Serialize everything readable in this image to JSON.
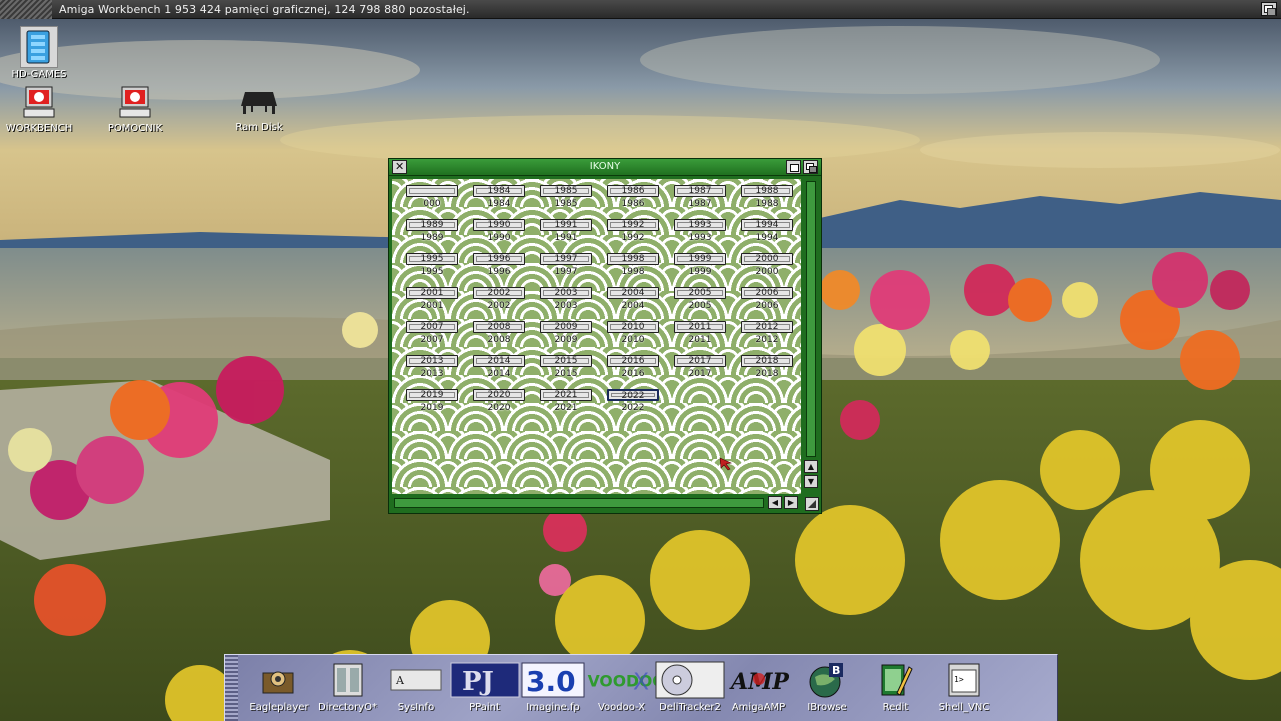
{
  "screen": {
    "title": "Amiga Workbench  1 953 424 pamięci graficznej, 124 798 880 pozostałej."
  },
  "desktop_icons": [
    {
      "label": "HD-GAMES"
    },
    {
      "label": "WORKBENCH"
    },
    {
      "label": "POMOCNIK"
    },
    {
      "label": "Ram Disk"
    }
  ],
  "window": {
    "title": "IKONY",
    "icons": [
      {
        "drawer": "",
        "label": "000"
      },
      {
        "drawer": "1984",
        "label": "1984"
      },
      {
        "drawer": "1985",
        "label": "1985"
      },
      {
        "drawer": "1986",
        "label": "1986"
      },
      {
        "drawer": "1987",
        "label": "1987"
      },
      {
        "drawer": "1988",
        "label": "1988"
      },
      {
        "drawer": "1989",
        "label": "1989"
      },
      {
        "drawer": "1990",
        "label": "1990"
      },
      {
        "drawer": "1991",
        "label": "1991"
      },
      {
        "drawer": "1992",
        "label": "1992"
      },
      {
        "drawer": "1993",
        "label": "1993"
      },
      {
        "drawer": "1994",
        "label": "1994"
      },
      {
        "drawer": "1995",
        "label": "1995"
      },
      {
        "drawer": "1996",
        "label": "1996"
      },
      {
        "drawer": "1997",
        "label": "1997"
      },
      {
        "drawer": "1998",
        "label": "1998"
      },
      {
        "drawer": "1999",
        "label": "1999"
      },
      {
        "drawer": "2000",
        "label": "2000"
      },
      {
        "drawer": "2001",
        "label": "2001"
      },
      {
        "drawer": "2002",
        "label": "2002"
      },
      {
        "drawer": "2003",
        "label": "2003"
      },
      {
        "drawer": "2004",
        "label": "2004"
      },
      {
        "drawer": "2005",
        "label": "2005"
      },
      {
        "drawer": "2006",
        "label": "2006"
      },
      {
        "drawer": "2007",
        "label": "2007"
      },
      {
        "drawer": "2008",
        "label": "2008"
      },
      {
        "drawer": "2009",
        "label": "2009"
      },
      {
        "drawer": "2010",
        "label": "2010"
      },
      {
        "drawer": "2011",
        "label": "2011"
      },
      {
        "drawer": "2012",
        "label": "2012"
      },
      {
        "drawer": "2013",
        "label": "2013"
      },
      {
        "drawer": "2014",
        "label": "2014"
      },
      {
        "drawer": "2015",
        "label": "2015"
      },
      {
        "drawer": "2016",
        "label": "2016"
      },
      {
        "drawer": "2017",
        "label": "2017"
      },
      {
        "drawer": "2018",
        "label": "2018"
      },
      {
        "drawer": "2019",
        "label": "2019"
      },
      {
        "drawer": "2020",
        "label": "2020"
      },
      {
        "drawer": "2021",
        "label": "2021"
      },
      {
        "drawer": "2022",
        "label": "2022",
        "selected": true
      }
    ]
  },
  "dock": [
    {
      "label": "Eagleplayer",
      "icon": "speaker-icon"
    },
    {
      "label": "DirectoryO*",
      "icon": "file-manager-icon"
    },
    {
      "label": "SysInfo",
      "icon": "sysinfo-icon"
    },
    {
      "label": "PPaint",
      "icon": "ppaint-icon"
    },
    {
      "label": "Imagine.fp",
      "icon": "imagine-3d-icon"
    },
    {
      "label": "Voodoo-X",
      "icon": "voodoo-icon"
    },
    {
      "label": "DeliTracker2",
      "icon": "cd-disc-icon"
    },
    {
      "label": "AmigaAMP",
      "icon": "amp-icon"
    },
    {
      "label": "IBrowse",
      "icon": "globe-icon"
    },
    {
      "label": "Redit",
      "icon": "notepad-pencil-icon"
    },
    {
      "label": "Shell_VNC",
      "icon": "shell-icon"
    }
  ],
  "colors": {
    "window_frame": "#1f6d1f",
    "window_titlebar": "#3a9c3a",
    "pattern_green": "#8faf6a",
    "dock_base": "#8c90b8"
  }
}
